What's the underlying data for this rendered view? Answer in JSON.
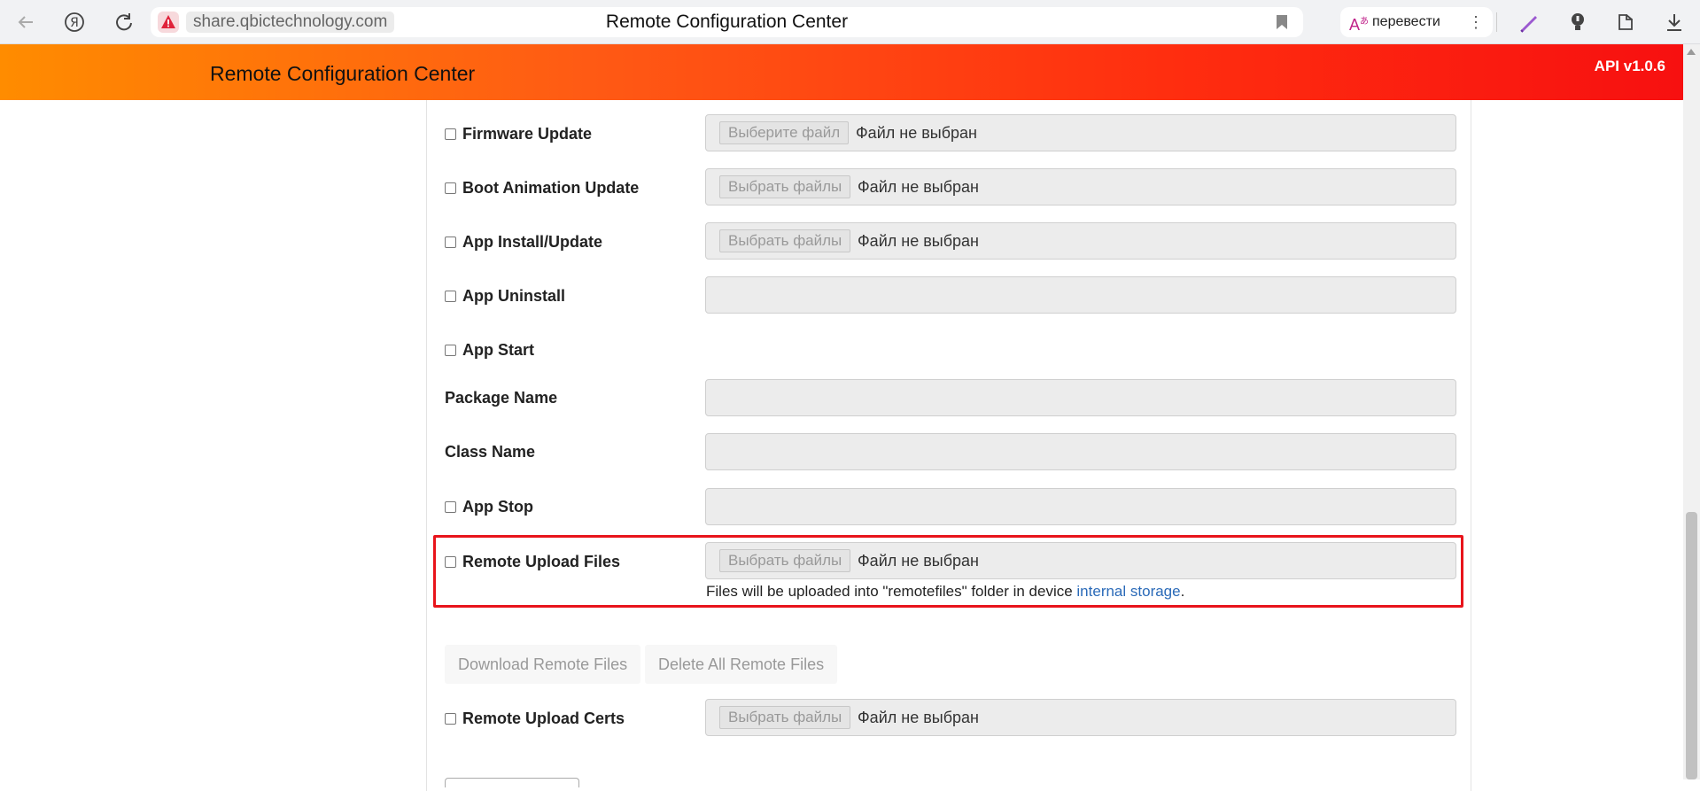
{
  "browser": {
    "url_host": "share.qbictechnology.com",
    "tab_title": "Remote Configuration Center",
    "translate_label": "перевести",
    "icons": [
      "back-arrow-icon",
      "yandex-logo-icon",
      "reload-icon",
      "security-warning-icon",
      "bookmark-icon",
      "translate-icon",
      "more-vertical-icon",
      "pen-icon",
      "lightbulb-icon",
      "extensions-icon",
      "download-icon"
    ]
  },
  "header": {
    "title": "Remote Configuration Center",
    "api_version": "API v1.0.6"
  },
  "form": {
    "firmware": {
      "label": "Firmware Update",
      "button": "Выберите файл",
      "status": "Файл не выбран"
    },
    "boot_animation": {
      "label": "Boot Animation Update",
      "button": "Выбрать файлы",
      "status": "Файл не выбран"
    },
    "app_install": {
      "label": "App Install/Update",
      "button": "Выбрать файлы",
      "status": "Файл не выбран"
    },
    "app_uninstall": {
      "label": "App Uninstall",
      "value": ""
    },
    "app_start": {
      "label": "App Start"
    },
    "package_name": {
      "label": "Package Name",
      "value": ""
    },
    "class_name": {
      "label": "Class Name",
      "value": ""
    },
    "app_stop": {
      "label": "App Stop",
      "value": ""
    },
    "remote_upload_files": {
      "label": "Remote Upload Files",
      "button": "Выбрать файлы",
      "status": "Файл не выбран",
      "note_prefix": "Files will be uploaded into \"remotefiles\" folder in device ",
      "note_link": "internal storage",
      "note_suffix": "."
    },
    "download_button": "Download Remote Files",
    "delete_button": "Delete All Remote Files",
    "remote_upload_certs": {
      "label": "Remote Upload Certs",
      "button": "Выбрать файлы",
      "status": "Файл не выбран"
    }
  },
  "colors": {
    "header_gradient_start": "#ff8c00",
    "header_gradient_end": "#f71010",
    "highlight_border": "#e8141b",
    "link": "#2a6ab8"
  }
}
